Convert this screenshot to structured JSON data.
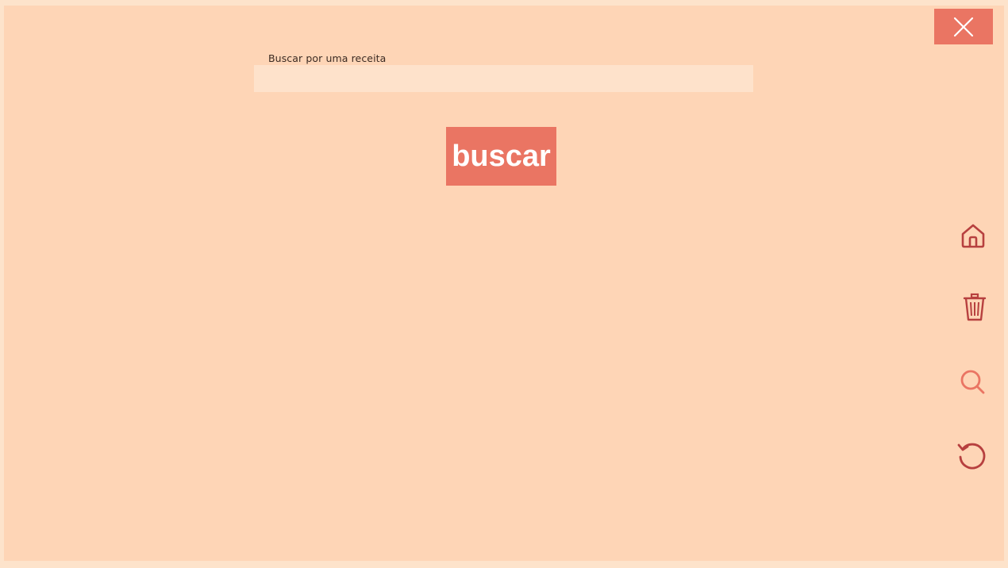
{
  "search": {
    "label": "Buscar por uma receita",
    "value": "",
    "placeholder": "",
    "button_label": "buscar"
  },
  "colors": {
    "background": "#FED5B6",
    "accent": "#EA7563",
    "icon_dark": "#B7403F",
    "icon_active": "#EA7563"
  },
  "icons": {
    "close": "close-icon",
    "sidebar": [
      "home-icon",
      "trash-icon",
      "search-icon",
      "refresh-icon"
    ],
    "active": "search-icon"
  }
}
